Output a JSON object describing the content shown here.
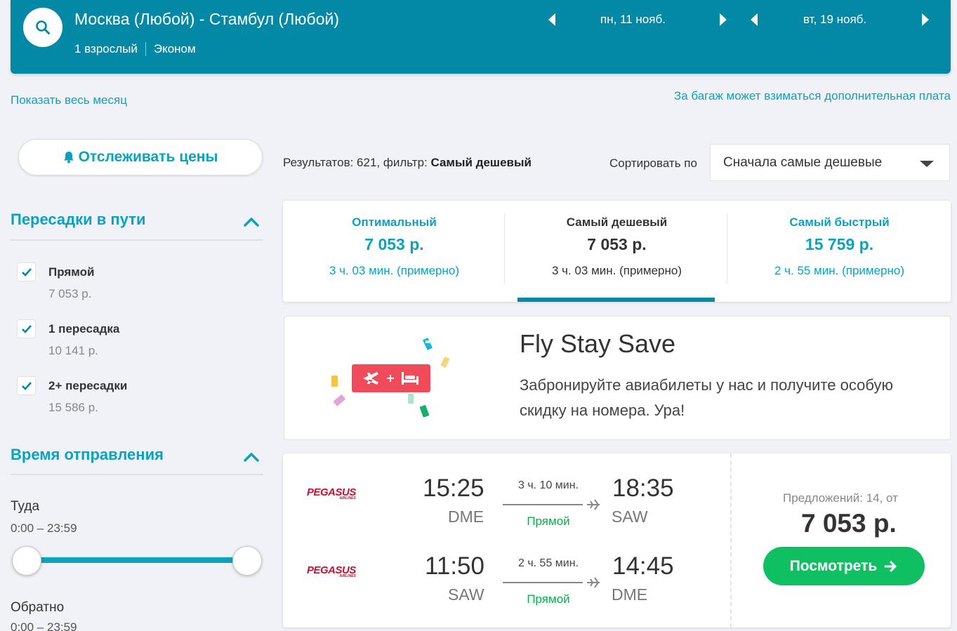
{
  "header": {
    "route": "Москва (Любой) - Стамбул (Любой)",
    "passengers": "1 взрослый",
    "cabin": "Эконом",
    "depart_date": "пн, 11 нояб.",
    "return_date": "вт, 19 нояб."
  },
  "links": {
    "show_month": "Показать весь месяц",
    "baggage_note": "За багаж может взиматься дополнительная плата"
  },
  "sidebar": {
    "track_button": "Отслеживать цены",
    "stops_title": "Пересадки в пути",
    "stops": [
      {
        "label": "Прямой",
        "price": "7 053 р.",
        "checked": true
      },
      {
        "label": "1 пересадка",
        "price": "10 141 р.",
        "checked": true
      },
      {
        "label": "2+ пересадки",
        "price": "15 586 р.",
        "checked": true
      }
    ],
    "departure_title": "Время отправления",
    "outbound_label": "Туда",
    "outbound_range": "0:00 – 23:59",
    "return_label": "Обратно",
    "return_range": "0:00 – 23:59"
  },
  "results": {
    "count_text": "Результатов: 621, фильтр: ",
    "filter": "Самый дешевый",
    "sort_label": "Сортировать по",
    "sort_value": "Сначала самые дешевые"
  },
  "tabs": [
    {
      "title": "Оптимальный",
      "price": "7 053 р.",
      "duration": "3 ч. 03 мин. (примерно)",
      "active": false
    },
    {
      "title": "Самый дешевый",
      "price": "7 053 р.",
      "duration": "3 ч. 03 мин. (примерно)",
      "active": true
    },
    {
      "title": "Самый быстрый",
      "price": "15 759 р.",
      "duration": "2 ч. 55 мин. (примерно)",
      "active": false
    }
  ],
  "promo": {
    "title": "Fly Stay Save",
    "text": "Забронируйте авиабилеты у нас и получите особую скидку на номера. Ура!",
    "icon": "plane-plus-bed-icon",
    "plus": "+"
  },
  "flight": {
    "legs": [
      {
        "airline": "PEGASUS",
        "airline_sub": "AIRLINES",
        "dep_time": "15:25",
        "dep_airport": "DME",
        "duration": "3 ч. 10 мин.",
        "type": "Прямой",
        "arr_time": "18:35",
        "arr_airport": "SAW"
      },
      {
        "airline": "PEGASUS",
        "airline_sub": "AIRLINES",
        "dep_time": "11:50",
        "dep_airport": "SAW",
        "duration": "2 ч. 55 мин.",
        "type": "Прямой",
        "arr_time": "14:45",
        "arr_airport": "DME"
      }
    ],
    "offers": "Предложений: 14, от",
    "price": "7 053 р.",
    "view_button": "Посмотреть"
  },
  "colors": {
    "brand": "#0388a6",
    "accent": "#0aa2c1",
    "green": "#0fc063",
    "airline_red": "#c8102e"
  }
}
